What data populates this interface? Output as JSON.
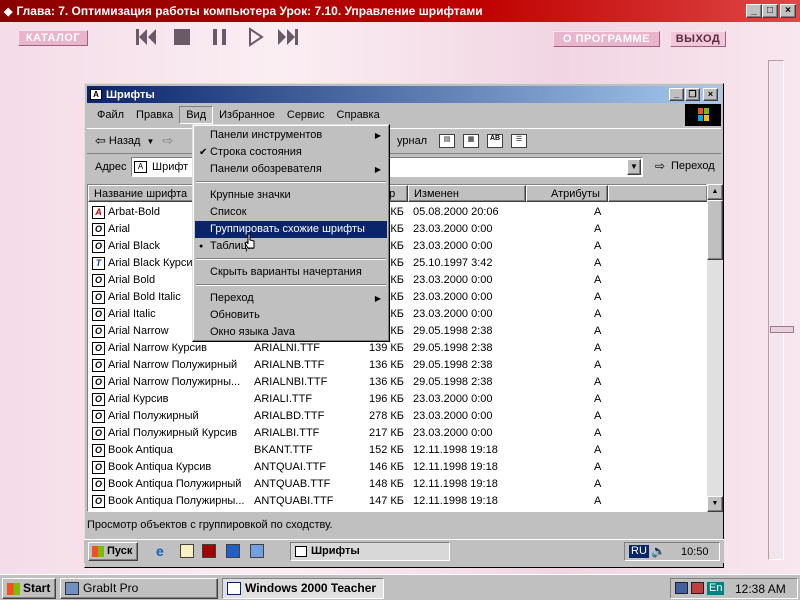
{
  "outer": {
    "title": "Глава:  7. Оптимизация работы компьютера Урок: 7.10. Управление шрифтами",
    "catalog_label": "КАТАЛОГ",
    "about_label": "О ПРОГРАММЕ",
    "exit_label": "ВЫХОД"
  },
  "window": {
    "title": "Шрифты",
    "menu": [
      "Файл",
      "Правка",
      "Вид",
      "Избранное",
      "Сервис",
      "Справка"
    ],
    "back_label": "Назад",
    "journal_label": "урнал",
    "address_label": "Адрес",
    "address_value": "Шрифт",
    "go_label": "Переход"
  },
  "columns": [
    "Название шрифта",
    "ер",
    "Изменен",
    "Атрибуты"
  ],
  "files": [
    {
      "name": "Arbat-Bold",
      "file": "",
      "size": "КБ",
      "date": "05.08.2000 20:06",
      "attr": "A",
      "icon": "A"
    },
    {
      "name": "Arial",
      "file": "",
      "size": "КБ",
      "date": "23.03.2000 0:00",
      "attr": "A",
      "icon": "O"
    },
    {
      "name": "Arial Black",
      "file": "",
      "size": "КБ",
      "date": "23.03.2000 0:00",
      "attr": "A",
      "icon": "O"
    },
    {
      "name": "Arial Black Курсив",
      "file": "",
      "size": "КБ",
      "date": "25.10.1997 3:42",
      "attr": "A",
      "icon": "T"
    },
    {
      "name": "Arial Bold",
      "file": "",
      "size": "КБ",
      "date": "23.03.2000 0:00",
      "attr": "A",
      "icon": "O"
    },
    {
      "name": "Arial Bold Italic",
      "file": "",
      "size": "КБ",
      "date": "23.03.2000 0:00",
      "attr": "A",
      "icon": "O"
    },
    {
      "name": "Arial Italic",
      "file": "",
      "size": "КБ",
      "date": "23.03.2000 0:00",
      "attr": "A",
      "icon": "O"
    },
    {
      "name": "Arial Narrow",
      "file": "",
      "size": "КБ",
      "date": "29.05.1998 2:38",
      "attr": "A",
      "icon": "O"
    },
    {
      "name": "Arial Narrow Курсив",
      "file": "ARIALNI.TTF",
      "size": "139 КБ",
      "date": "29.05.1998 2:38",
      "attr": "A",
      "icon": "O"
    },
    {
      "name": "Arial Narrow Полужирный",
      "file": "ARIALNB.TTF",
      "size": "136 КБ",
      "date": "29.05.1998 2:38",
      "attr": "A",
      "icon": "O"
    },
    {
      "name": "Arial Narrow Полужирны...",
      "file": "ARIALNBI.TTF",
      "size": "136 КБ",
      "date": "29.05.1998 2:38",
      "attr": "A",
      "icon": "O"
    },
    {
      "name": "Arial Курсив",
      "file": "ARIALI.TTF",
      "size": "196 КБ",
      "date": "23.03.2000 0:00",
      "attr": "A",
      "icon": "O"
    },
    {
      "name": "Arial Полужирный",
      "file": "ARIALBD.TTF",
      "size": "278 КБ",
      "date": "23.03.2000 0:00",
      "attr": "A",
      "icon": "O"
    },
    {
      "name": "Arial Полужирный Курсив",
      "file": "ARIALBI.TTF",
      "size": "217 КБ",
      "date": "23.03.2000 0:00",
      "attr": "A",
      "icon": "O"
    },
    {
      "name": "Book Antiqua",
      "file": "BKANT.TTF",
      "size": "152 КБ",
      "date": "12.11.1998 19:18",
      "attr": "A",
      "icon": "O"
    },
    {
      "name": "Book Antiqua Курсив",
      "file": "ANTQUAI.TTF",
      "size": "146 КБ",
      "date": "12.11.1998 19:18",
      "attr": "A",
      "icon": "O"
    },
    {
      "name": "Book Antiqua Полужирный",
      "file": "ANTQUAB.TTF",
      "size": "148 КБ",
      "date": "12.11.1998 19:18",
      "attr": "A",
      "icon": "O"
    },
    {
      "name": "Book Antiqua Полужирны...",
      "file": "ANTQUABI.TTF",
      "size": "147 КБ",
      "date": "12.11.1998 19:18",
      "attr": "A",
      "icon": "O"
    }
  ],
  "dropdown": [
    {
      "label": "Панели инструментов",
      "arrow": true
    },
    {
      "label": "Строка состояния",
      "check": true
    },
    {
      "label": "Панели обозревателя",
      "arrow": true
    },
    {
      "sep": true
    },
    {
      "label": "Крупные значки"
    },
    {
      "label": "Список"
    },
    {
      "label": "Группировать схожие шрифты",
      "highlight": true
    },
    {
      "label": "Таблица",
      "radio": true
    },
    {
      "sep": true
    },
    {
      "label": "Скрыть варианты начертания"
    },
    {
      "sep": true
    },
    {
      "label": "Переход",
      "arrow": true
    },
    {
      "label": "Обновить"
    },
    {
      "label": "Окно языка Java"
    }
  ],
  "status_text": "Просмотр объектов с группировкой по сходству.",
  "inner_taskbar": {
    "start_label": "Пуск",
    "task_label": "Шрифты",
    "lang": "RU",
    "clock": "10:50"
  },
  "taskbar": {
    "start_label": "Start",
    "task1": "GrabIt Pro",
    "task2": "Windows 2000 Teacher",
    "lang": "En",
    "clock": "12:38 AM"
  },
  "colors": {
    "title_red": "#c00000",
    "title_blue": "#0a246a",
    "pink": "#e8b5cc"
  }
}
